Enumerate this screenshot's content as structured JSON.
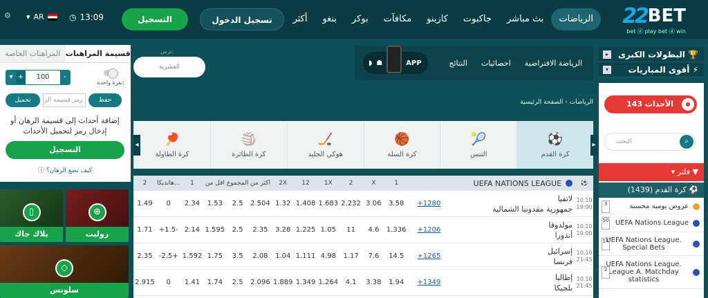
{
  "header": {
    "logo_num": "22",
    "logo_word": "BET",
    "logo_tag": "bet ⓓ play bet ⓓ win",
    "nav": [
      "الرياضات",
      "بث مباشر",
      "جاكبوت",
      "كازينو",
      "مكافآت",
      "بوكر",
      "بنغو",
      "أكثر"
    ],
    "register": "التسجيل",
    "login": "تسجيل الدخول",
    "time": "13:09",
    "lang": "AR"
  },
  "betslip": {
    "tab_active": "قسيمة المراهنات",
    "tab_other": "المراهنات الخاصة",
    "stake": "100",
    "one_click": "نقرة واحدة:",
    "load": "تحميل",
    "code_placeholder": "رمز قسيمة الر",
    "save": "حفظ",
    "message": "إضافة أحداث إلى قسيمة الرهان أو إدخال رمز لتحميل الأحداث",
    "register": "التسجيل",
    "how": "كيف تضع الرهان؟"
  },
  "promos": {
    "roulette": "روليت",
    "blackjack": "بلاك جاك",
    "slots": "سلوتس"
  },
  "center": {
    "search_caption": "ترس:",
    "search_value": "العشرية",
    "subnav": [
      "الرياضة الافتراضية",
      "احصائيات",
      "النتائج"
    ],
    "app": "APP",
    "breadcrumb_home": "الصفحة الرئيسية",
    "breadcrumb_sep": "›",
    "breadcrumb_current": "الرياضات",
    "sports": [
      {
        "icon": "⚽",
        "label": "كرة القدم"
      },
      {
        "icon": "🎾",
        "label": "التنس"
      },
      {
        "icon": "🏀",
        "label": "كرة السلة"
      },
      {
        "icon": "🏒",
        "label": "هوكي الجليد"
      },
      {
        "icon": "🏐",
        "label": "كرة الطائرة"
      },
      {
        "icon": "🏓",
        "label": "كرة الطاولة"
      }
    ]
  },
  "table": {
    "league": "UEFA NATIONS LEAGUE",
    "columns": [
      "1",
      "X",
      "2",
      "1X",
      "12",
      "2X",
      "اكثر من",
      "المجموع",
      "اقل من",
      "1",
      "هانديكا...",
      "2"
    ],
    "rows": [
      {
        "date": "10.10",
        "time": "19:00",
        "t1": "لاتفيا",
        "t2": "جمهورية مقدونيا الشمالية",
        "more": "+1280",
        "odds": [
          "3.58",
          "3.06",
          "2.232",
          "1.683",
          "1.408",
          "1.32",
          "2.504",
          "2.5",
          "1.53",
          "2.34",
          "0",
          "1.49"
        ]
      },
      {
        "date": "10.10",
        "time": "19:00",
        "t1": "مولدوفا",
        "t2": "أندورا",
        "more": "+1206",
        "odds": [
          "1.336",
          "4.6",
          "11",
          "1.05",
          "1.225",
          "3.28",
          "2.35",
          "2.5",
          "1.595",
          "2.14",
          "+1.5-",
          "1.71"
        ]
      },
      {
        "date": "10.10",
        "time": "21:45",
        "t1": "إسرائيل",
        "t2": "فرنسا",
        "more": "+1265",
        "odds": [
          "14.5",
          "7.6",
          "1.17",
          "4.98",
          "1.111",
          "1.04",
          "2.08",
          "3.5",
          "1.75",
          "1.592",
          "-2.5+",
          "2.35"
        ]
      },
      {
        "date": "10.10",
        "time": "21:45",
        "t1": "إطاليا",
        "t2": "بلجيكا",
        "more": "+1349",
        "odds": [
          "1.94",
          "3.38",
          "4.1",
          "1.264",
          "1.349",
          "1.889",
          "2.096",
          "2.5",
          "1.74",
          "1.41",
          "0",
          "2.915"
        ]
      }
    ]
  },
  "right": {
    "top_leagues": "البطولات الكبرى",
    "top_matches": "أقوى المباريات",
    "live": "الأحداث 143 :LIVE",
    "search": "البحث",
    "filter": "فلتر",
    "category": "كرة القدم (1439)",
    "items": [
      {
        "count": "3",
        "label": "عروض يومية محسنة"
      },
      {
        "count": "50",
        "label": "UEFA Nations League"
      },
      {
        "count": "14",
        "label": "UEFA Nations League. Special Bets"
      },
      {
        "count": "2",
        "label": "UEFA Nations League. League A. Matchday statistics"
      }
    ]
  },
  "colors": {
    "brand": "#0f4f56",
    "green": "#18a34b",
    "red": "#e53935",
    "accent": "#157a84"
  }
}
